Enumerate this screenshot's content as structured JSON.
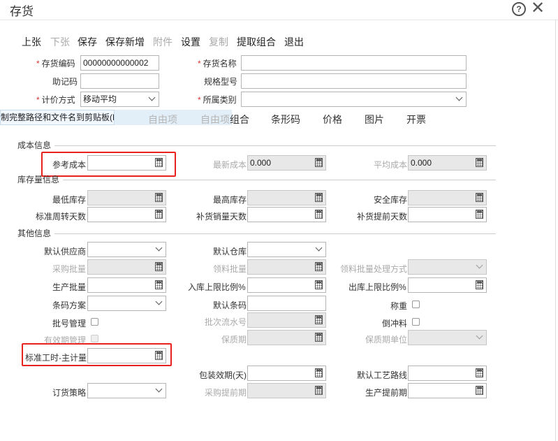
{
  "window": {
    "title": "存货",
    "help_glyph": "?",
    "close_glyph": "✕"
  },
  "toolbar": {
    "prev": "上张",
    "next": "下张",
    "save": "保存",
    "save_new": "保存新增",
    "attachment": "附件",
    "settings": "设置",
    "copy": "复制",
    "extract": "提取组合",
    "exit": "退出"
  },
  "header": {
    "code_label": "存货编码",
    "code_value": "00000000000002",
    "name_label": "存货名称",
    "name_value": "",
    "mnemonic_label": "助记码",
    "spec_label": "规格型号",
    "costing_label": "计价方式",
    "costing_value": "移动平均",
    "category_label": "所属类别",
    "required_mark": "*"
  },
  "tooltip": "制完整路径和文件名到剪贴板(F)",
  "tabs": [
    "自由项",
    "自由项",
    "组合",
    "条形码",
    "价格",
    "图片",
    "开票"
  ],
  "cost": {
    "section": "成本信息",
    "ref_cost_label": "参考成本",
    "latest_cost_label": "最新成本",
    "latest_cost_value": "0.000",
    "avg_cost_label": "平均成本",
    "avg_cost_value": "0.000"
  },
  "stock": {
    "section": "库存量信息",
    "min_label": "最低库存",
    "max_label": "最高库存",
    "safe_label": "安全库存",
    "turnover_label": "标准周转天数",
    "replenish_days_label": "补货销量天数",
    "lead_days_label": "补货提前天数"
  },
  "other": {
    "section": "其他信息",
    "supplier_label": "默认供应商",
    "warehouse_label": "默认仓库",
    "purchase_batch_label": "采购批量",
    "pick_batch_label": "领料批量",
    "pick_batch_mode_label": "领料批量处理方式",
    "prod_batch_label": "生产批量",
    "in_limit_label": "入库上限比例%",
    "out_limit_label": "出库上限比例%",
    "barcode_scheme_label": "条码方案",
    "default_barcode_label": "默认条码",
    "weigh_label": "称重",
    "lot_label": "批号管理",
    "lot_seq_label": "批次流水号",
    "backflush_label": "倒冲料",
    "expiry_label": "有效期管理",
    "shelf_life_label": "保质期",
    "shelf_unit_label": "保质期单位",
    "std_hours_label": "标准工时-主计量",
    "pack_days_label": "包装效期(天)",
    "route_label": "默认工艺路线",
    "order_policy_label": "订货策略",
    "purchase_lead_label": "采购提前期",
    "prod_lead_label": "生产提前期"
  },
  "colors": {
    "highlight": "#e8231f",
    "disabled_bg": "#e8e8e8"
  }
}
